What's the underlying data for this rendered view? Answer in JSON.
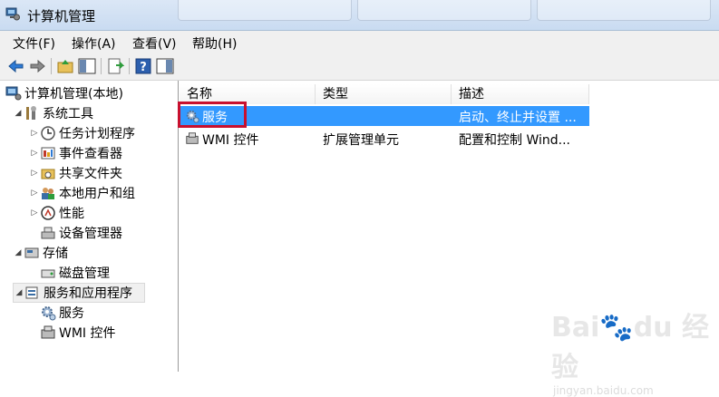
{
  "window": {
    "title": "计算机管理"
  },
  "menubar": {
    "items": [
      "文件(F)",
      "操作(A)",
      "查看(V)",
      "帮助(H)"
    ]
  },
  "tree": [
    {
      "label": "计算机管理(本地)",
      "icon": "computer-management-icon",
      "level": 0
    },
    {
      "label": "系统工具",
      "icon": "system-tools-icon",
      "level": 1,
      "expanded": true
    },
    {
      "label": "任务计划程序",
      "icon": "task-scheduler-icon",
      "level": 2,
      "expanded": false
    },
    {
      "label": "事件查看器",
      "icon": "event-viewer-icon",
      "level": 2,
      "expanded": false
    },
    {
      "label": "共享文件夹",
      "icon": "shared-folders-icon",
      "level": 2,
      "expanded": false
    },
    {
      "label": "本地用户和组",
      "icon": "users-groups-icon",
      "level": 2,
      "expanded": false
    },
    {
      "label": "性能",
      "icon": "performance-icon",
      "level": 2,
      "expanded": false
    },
    {
      "label": "设备管理器",
      "icon": "device-manager-icon",
      "level": 2
    },
    {
      "label": "存储",
      "icon": "storage-icon",
      "level": 1,
      "expanded": true
    },
    {
      "label": "磁盘管理",
      "icon": "disk-management-icon",
      "level": 2
    },
    {
      "label": "服务和应用程序",
      "icon": "services-apps-icon",
      "level": 1,
      "expanded": true,
      "selected": true
    },
    {
      "label": "服务",
      "icon": "services-gear-icon",
      "level": 2
    },
    {
      "label": "WMI 控件",
      "icon": "wmi-control-icon",
      "level": 2
    }
  ],
  "list": {
    "columns": [
      "名称",
      "类型",
      "描述"
    ],
    "rows": [
      {
        "name": "服务",
        "type": "",
        "desc": "启动、终止并设置 ...",
        "selected": true
      },
      {
        "name": "WMI 控件",
        "type": "扩展管理单元",
        "desc": "配置和控制 Wind..."
      }
    ]
  },
  "watermark": {
    "brand": "Bai",
    "sub": "jingyan.baidu.com"
  },
  "colors": {
    "selection": "#3399ff",
    "highlight_box": "#c8102e",
    "titlebar": "#d3e2f4"
  }
}
